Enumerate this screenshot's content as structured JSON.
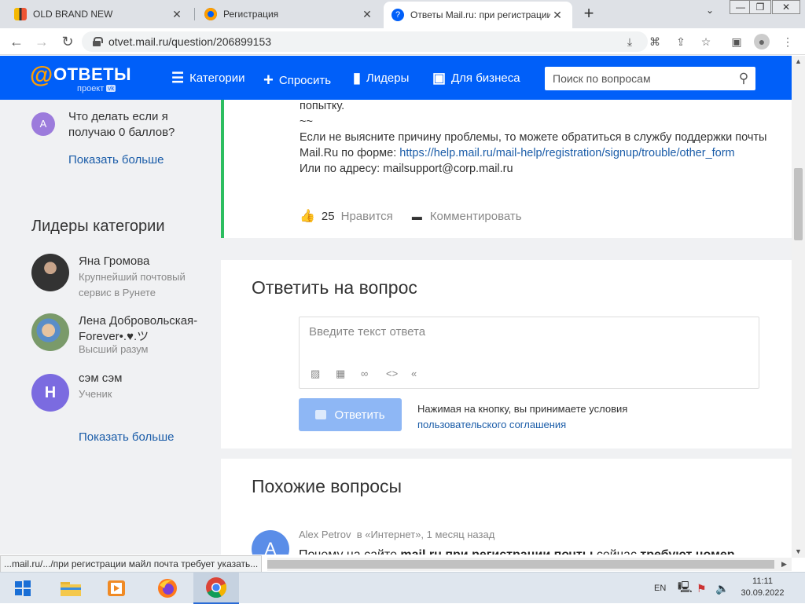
{
  "browser": {
    "tabs": [
      {
        "title": "OLD BRAND NEW",
        "close": "✕"
      },
      {
        "title": "Регистрация",
        "close": "✕"
      },
      {
        "title": "Ответы Mail.ru: при регистрации",
        "close": "✕"
      }
    ],
    "new_tab": "+",
    "tab_search": "⌄",
    "window_controls": {
      "minimize": "—",
      "restore": "❐",
      "close": "✕"
    },
    "url": "otvet.mail.ru/question/206899153"
  },
  "site": {
    "logo_at": "@",
    "logo_text": "ОТВЕТЫ",
    "logo_sub": "проект",
    "logo_badge": "vk",
    "nav": {
      "categories": "Категории",
      "ask": "Спросить",
      "leaders": "Лидеры",
      "business": "Для бизнеса"
    },
    "search_placeholder": "Поиск по вопросам"
  },
  "sidebar": {
    "question": {
      "avatar_letter": "A",
      "text": "Что делать если я получаю 0 баллов?"
    },
    "show_more_1": "Показать больше",
    "leaders_heading": "Лидеры категории",
    "leaders": [
      {
        "name": "Яна Громова",
        "status": "Крупнейший почтовый сервис в Рунете"
      },
      {
        "name": "Лена Добровольская-Forever•.♥.ツ",
        "status": "Высший разум"
      },
      {
        "avatar_letter": "Н",
        "name": "сэм сэм",
        "status": "Ученик"
      }
    ],
    "show_more_2": "Показать больше"
  },
  "answer": {
    "line1": "попытку.",
    "line2": "~~",
    "line3": "Если не выясните причину проблемы, то можете обратиться в службу поддержки почты Mail.Ru по форме: ",
    "link": "https://help.mail.ru/mail-help/registration/signup/trouble/other_form",
    "line4": "Или по адресу: mailsupport@corp.mail.ru",
    "likes": "25",
    "like_label": "Нравится",
    "comment_label": "Комментировать"
  },
  "reply": {
    "title": "Ответить на вопрос",
    "placeholder": "Введите текст ответа",
    "button": "Ответить",
    "terms_text": "Нажимая на кнопку, вы принимаете условия",
    "terms_link": "пользовательского соглашения"
  },
  "similar": {
    "title": "Похожие вопросы",
    "author": "Alex Petrov",
    "meta": "в «Интернет», 1 месяц назад",
    "avatar_letter": "A",
    "question_parts": [
      "Почему на сайте ",
      "mail.ru",
      " ",
      "при регистрации почты",
      " сейчас ",
      "требуют номер"
    ]
  },
  "status_url": "...mail.ru/.../при регистрации майл почта требует указать...",
  "taskbar": {
    "lang": "EN",
    "time": "11:11",
    "date": "30.09.2022"
  },
  "colors": {
    "header_blue": "#005ff9",
    "logo_orange": "#ff9e00",
    "accent_green": "#2dbe60",
    "link_blue": "#1a5ca8",
    "button_disabled": "#8eb7f5"
  }
}
